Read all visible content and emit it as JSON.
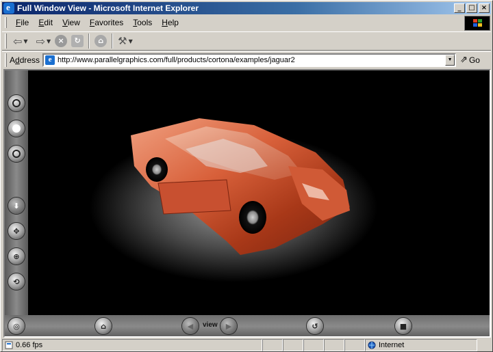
{
  "window": {
    "title": "Full Window View - Microsoft Internet Explorer"
  },
  "menu": {
    "items": [
      {
        "key": "F",
        "rest": "ile"
      },
      {
        "key": "E",
        "rest": "dit"
      },
      {
        "key": "V",
        "rest": "iew"
      },
      {
        "key": "F",
        "rest": "avorites",
        "prefix": ""
      },
      {
        "key": "T",
        "rest": "ools"
      },
      {
        "key": "H",
        "rest": "elp"
      }
    ]
  },
  "address": {
    "label": "Address",
    "label_key": "d",
    "url": "http://www.parallelgraphics.com/full/products/cortona/examples/jaguar2",
    "go_label": "Go"
  },
  "viewer": {
    "view_label": "view"
  },
  "status": {
    "fps": "0.66 fps",
    "zone": "Internet"
  },
  "icons": {
    "back": "back-arrow-icon",
    "forward": "forward-arrow-icon",
    "stop": "stop-icon",
    "refresh": "refresh-icon",
    "home": "home-icon",
    "tools": "tools-icon"
  }
}
